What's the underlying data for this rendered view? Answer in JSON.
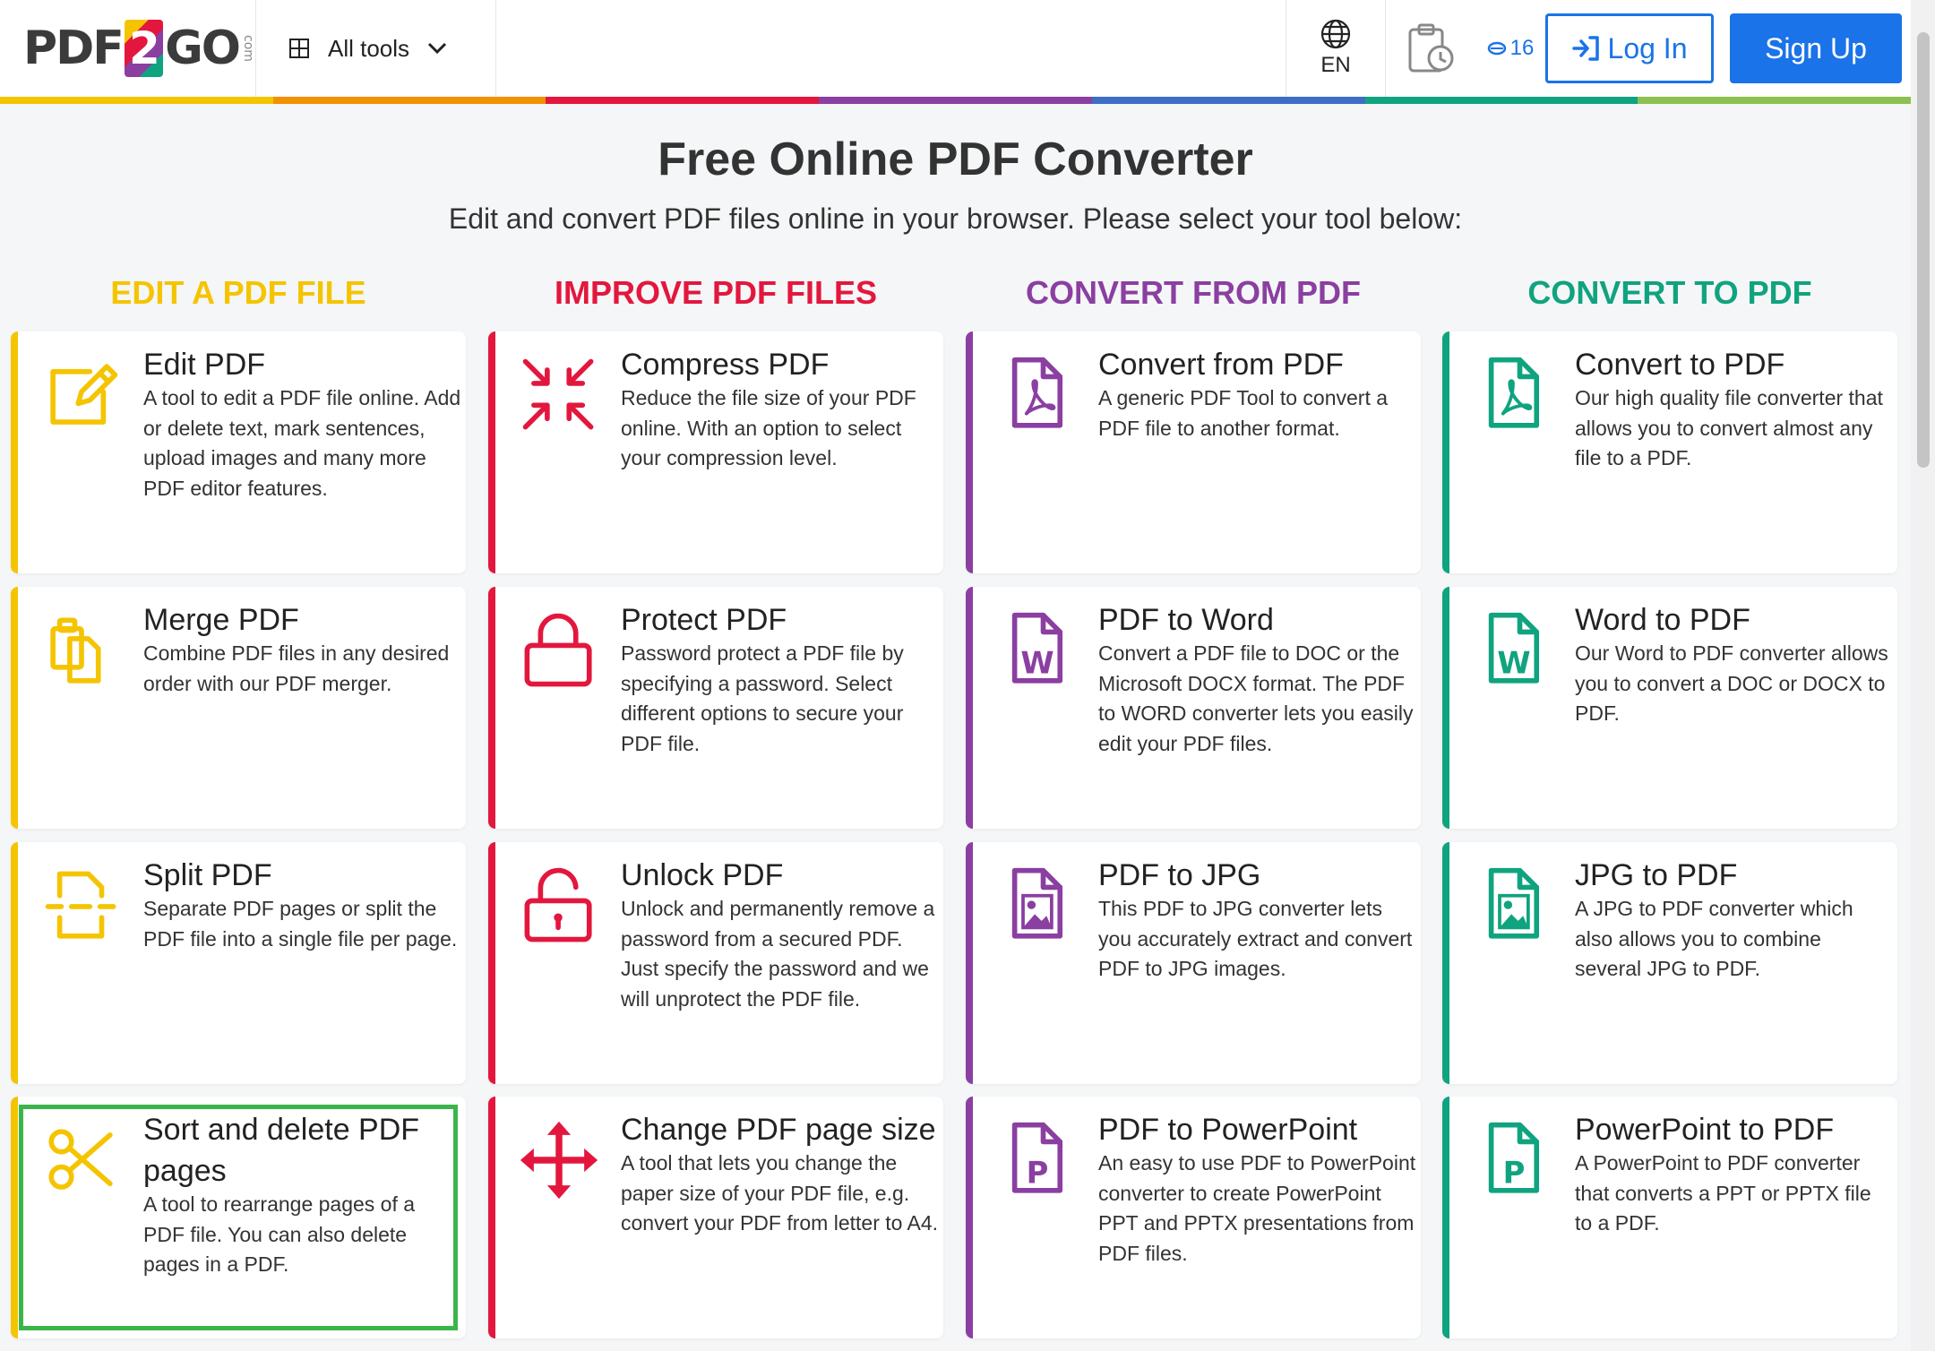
{
  "header": {
    "logo": {
      "pre": "PDF",
      "two": "2",
      "post": "GO",
      "com": "com"
    },
    "all_tools": "All tools",
    "lang": "EN",
    "credits": "16",
    "login": "Log In",
    "signup": "Sign Up"
  },
  "colors": {
    "edit": "#f5c400",
    "improve": "#e3173e",
    "from": "#8a3fa1",
    "to": "#10a37f",
    "blue": "#1a73e8",
    "selected": "#3bb54a"
  },
  "page": {
    "title": "Free Online PDF Converter",
    "subtitle": "Edit and convert PDF files online in your browser. Please select your tool below:"
  },
  "columns": [
    {
      "heading": "EDIT A PDF FILE"
    },
    {
      "heading": "IMPROVE PDF FILES"
    },
    {
      "heading": "CONVERT FROM PDF"
    },
    {
      "heading": "CONVERT TO PDF"
    }
  ],
  "tools": [
    [
      {
        "title": "Edit PDF",
        "desc": "A tool to edit a PDF file online. Add or delete text, mark sentences, upload images and many more PDF editor features.",
        "icon": "edit-icon"
      },
      {
        "title": "Merge PDF",
        "desc": "Combine PDF files in any desired order with our PDF merger.",
        "icon": "merge-icon"
      },
      {
        "title": "Split PDF",
        "desc": "Separate PDF pages or split the PDF file into a single file per page.",
        "icon": "split-icon"
      },
      {
        "title": "Sort and delete PDF pages",
        "desc": "A tool to rearrange pages of a PDF file. You can also delete pages in a PDF.",
        "icon": "scissors-icon"
      }
    ],
    [
      {
        "title": "Compress PDF",
        "desc": "Reduce the file size of your PDF online. With an option to select your compression level.",
        "icon": "compress-icon"
      },
      {
        "title": "Protect PDF",
        "desc": "Password protect a PDF file by specifying a password. Select different options to secure your PDF file.",
        "icon": "lock-icon"
      },
      {
        "title": "Unlock PDF",
        "desc": "Unlock and permanently remove a password from a secured PDF. Just specify the password and we will unprotect the PDF file.",
        "icon": "unlock-icon"
      },
      {
        "title": "Change PDF page size",
        "desc": "A tool that lets you change the paper size of your PDF file, e.g. convert your PDF from letter to A4.",
        "icon": "resize-arrows-icon"
      }
    ],
    [
      {
        "title": "Convert from PDF",
        "desc": "A generic PDF Tool to convert a PDF file to another format.",
        "icon": "pdf-file-icon"
      },
      {
        "title": "PDF to Word",
        "desc": "Convert a PDF file to DOC or the Microsoft DOCX format. The PDF to WORD converter lets you easily edit your PDF files.",
        "icon": "word-file-icon",
        "letter": "W"
      },
      {
        "title": "PDF to JPG",
        "desc": "This PDF to JPG converter lets you accurately extract and convert PDF to JPG images.",
        "icon": "image-file-icon"
      },
      {
        "title": "PDF to PowerPoint",
        "desc": "An easy to use PDF to PowerPoint converter to create PowerPoint PPT and PPTX presentations from PDF files.",
        "icon": "powerpoint-file-icon",
        "letter": "P"
      }
    ],
    [
      {
        "title": "Convert to PDF",
        "desc": "Our high quality file converter that allows you to convert almost any file to a PDF.",
        "icon": "pdf-file-icon"
      },
      {
        "title": "Word to PDF",
        "desc": "Our Word to PDF converter allows you to convert a DOC or DOCX to PDF.",
        "icon": "word-file-icon",
        "letter": "W"
      },
      {
        "title": "JPG to PDF",
        "desc": "A JPG to PDF converter which also allows you to combine several JPG to PDF.",
        "icon": "image-file-icon"
      },
      {
        "title": "PowerPoint to PDF",
        "desc": "A PowerPoint to PDF converter that converts a PPT or PPTX file to a PDF.",
        "icon": "powerpoint-file-icon",
        "letter": "P"
      }
    ]
  ]
}
